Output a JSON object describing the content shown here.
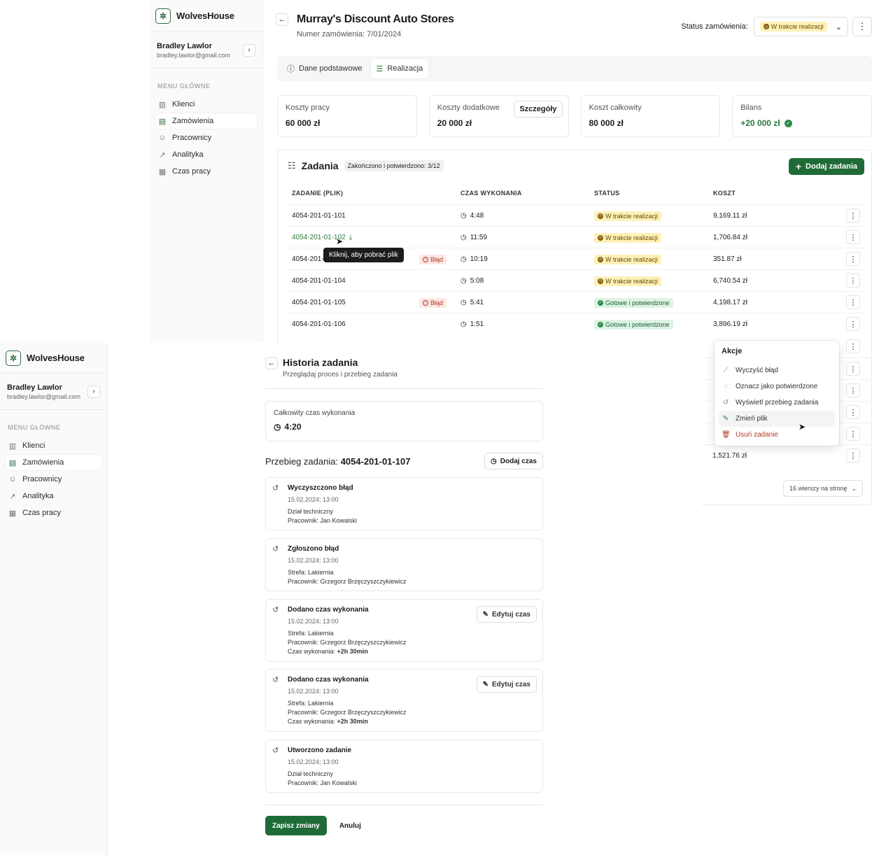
{
  "brand": {
    "name": "WolvesHouse"
  },
  "user": {
    "name": "Bradley Lawlor",
    "email": "bradley.lawlor@gmail.com"
  },
  "menu": {
    "label": "MENU GŁÓWNE",
    "items": [
      {
        "label": "Klienci",
        "icon": "building-icon"
      },
      {
        "label": "Zamówienia",
        "icon": "clipboard-icon"
      },
      {
        "label": "Pracownicy",
        "icon": "users-icon"
      },
      {
        "label": "Analityka",
        "icon": "chart-icon"
      },
      {
        "label": "Czas pracy",
        "icon": "table-icon"
      }
    ]
  },
  "order": {
    "title": "Murray's Discount Auto Stores",
    "number": "Numer zamówienia: 7/01/2024",
    "status_label": "Status zamówienia:",
    "status_value": "W trakcie realizacji"
  },
  "tabs": [
    {
      "label": "Dane podstawowe"
    },
    {
      "label": "Realizacja"
    }
  ],
  "cards": {
    "labor": {
      "label": "Koszty pracy",
      "value": "60 000 zł"
    },
    "extra": {
      "label": "Koszty dodatkowe",
      "value": "20 000 zł",
      "button": "Szczegóły"
    },
    "total": {
      "label": "Koszt całkowity",
      "value": "80 000 zł"
    },
    "balance": {
      "label": "Bilans",
      "value": "+20 000 zł"
    }
  },
  "tasks": {
    "title": "Zadania",
    "chip": "Zakończono i potwierdzono: 3/12",
    "add_button": "Dodaj zadania",
    "columns": {
      "name": "ZADANIE (PLIK)",
      "time": "CZAS WYKONANIA",
      "status": "STATUS",
      "cost": "KOSZT"
    },
    "error_label": "Błąd",
    "rows": [
      {
        "name": "4054-201-01-101",
        "time": "4:48",
        "status": "W trakcie realizacji",
        "cost": "9,169.11 zł"
      },
      {
        "name": "4054-201-01-102",
        "time": "11:59",
        "status": "W trakcie realizacji",
        "cost": "1,706.84 zł"
      },
      {
        "name": "4054-201-0",
        "time": "10:19",
        "status": "W trakcie realizacji",
        "cost": "351.87 zł"
      },
      {
        "name": "4054-201-01-104",
        "time": "5:08",
        "status": "W trakcie realizacji",
        "cost": "6,740.54 zł"
      },
      {
        "name": "4054-201-01-105",
        "time": "5:41",
        "status": "Gotowe i potwierdzone",
        "cost": "4,198.17 zł"
      },
      {
        "name": "4054-201-01-106",
        "time": "1:51",
        "status": "Gotowe i potwierdzone",
        "cost": "3,896.19 zł"
      }
    ],
    "tooltip": "Kliknij, aby pobrać plik",
    "last_cost": "1,521.76 zł",
    "pager": "16 wierszy na stronę"
  },
  "actions_menu": {
    "title": "Akcje",
    "items": [
      {
        "label": "Wyczyść błąd",
        "icon": "eraser-icon"
      },
      {
        "label": "Oznacz jako potwierdzone",
        "icon": "check-circle-icon"
      },
      {
        "label": "Wyświetl przebieg zadania",
        "icon": "history-icon"
      },
      {
        "label": "Zmień plik",
        "icon": "file-edit-icon"
      },
      {
        "label": "Usuń zadanie",
        "icon": "trash-icon"
      }
    ]
  },
  "history": {
    "title": "Historia zadania",
    "subtitle": "Przeglądaj proces i przebieg zadania",
    "total_label": "Całkowity czas wykonania",
    "total_value": "4:20",
    "heading_prefix": "Przebieg zadania: ",
    "task_id": "4054-201-01-107",
    "add_time": "Dodaj czas",
    "edit_time": "Edytuj czas",
    "events": [
      {
        "title": "Wyczyszczono błąd",
        "date": "15.02.2024; 13:00",
        "line1": "Dział techniczny",
        "line2": "Pracownik: Jan Kowalski"
      },
      {
        "title": "Zgłoszono błąd",
        "date": "15.02.2024; 13:00",
        "line1": "Strefa: Lakiernia",
        "line2": "Pracownik: Grzegorz Brzęczyszczykiewicz"
      },
      {
        "title": "Dodano czas wykonania",
        "date": "15.02.2024; 13:00",
        "line1": "Strefa: Lakiernia",
        "line2": "Pracownik: Grzegorz Brzęczyszczykiewicz",
        "line3_label": "Czas wykonania: ",
        "line3_value": "+2h 30min"
      },
      {
        "title": "Dodano czas wykonania",
        "date": "15.02.2024; 13:00",
        "line1": "Strefa: Lakiernia",
        "line2": "Pracownik: Grzegorz Brzęczyszczykiewicz",
        "line3_label": "Czas wykonania: ",
        "line3_value": "+2h 30min"
      },
      {
        "title": "Utworzono zadanie",
        "date": "15.02.2024; 13:00",
        "line1": "Dział techniczny",
        "line2": "Pracownik: Jan Kowalski"
      }
    ],
    "save": "Zapisz zmiany",
    "cancel": "Anuluj"
  },
  "colors": {
    "accent": "#1f6b38",
    "warning_bg": "#fdf1b8",
    "success_bg": "#ddf3e3",
    "danger": "#b03a25"
  }
}
